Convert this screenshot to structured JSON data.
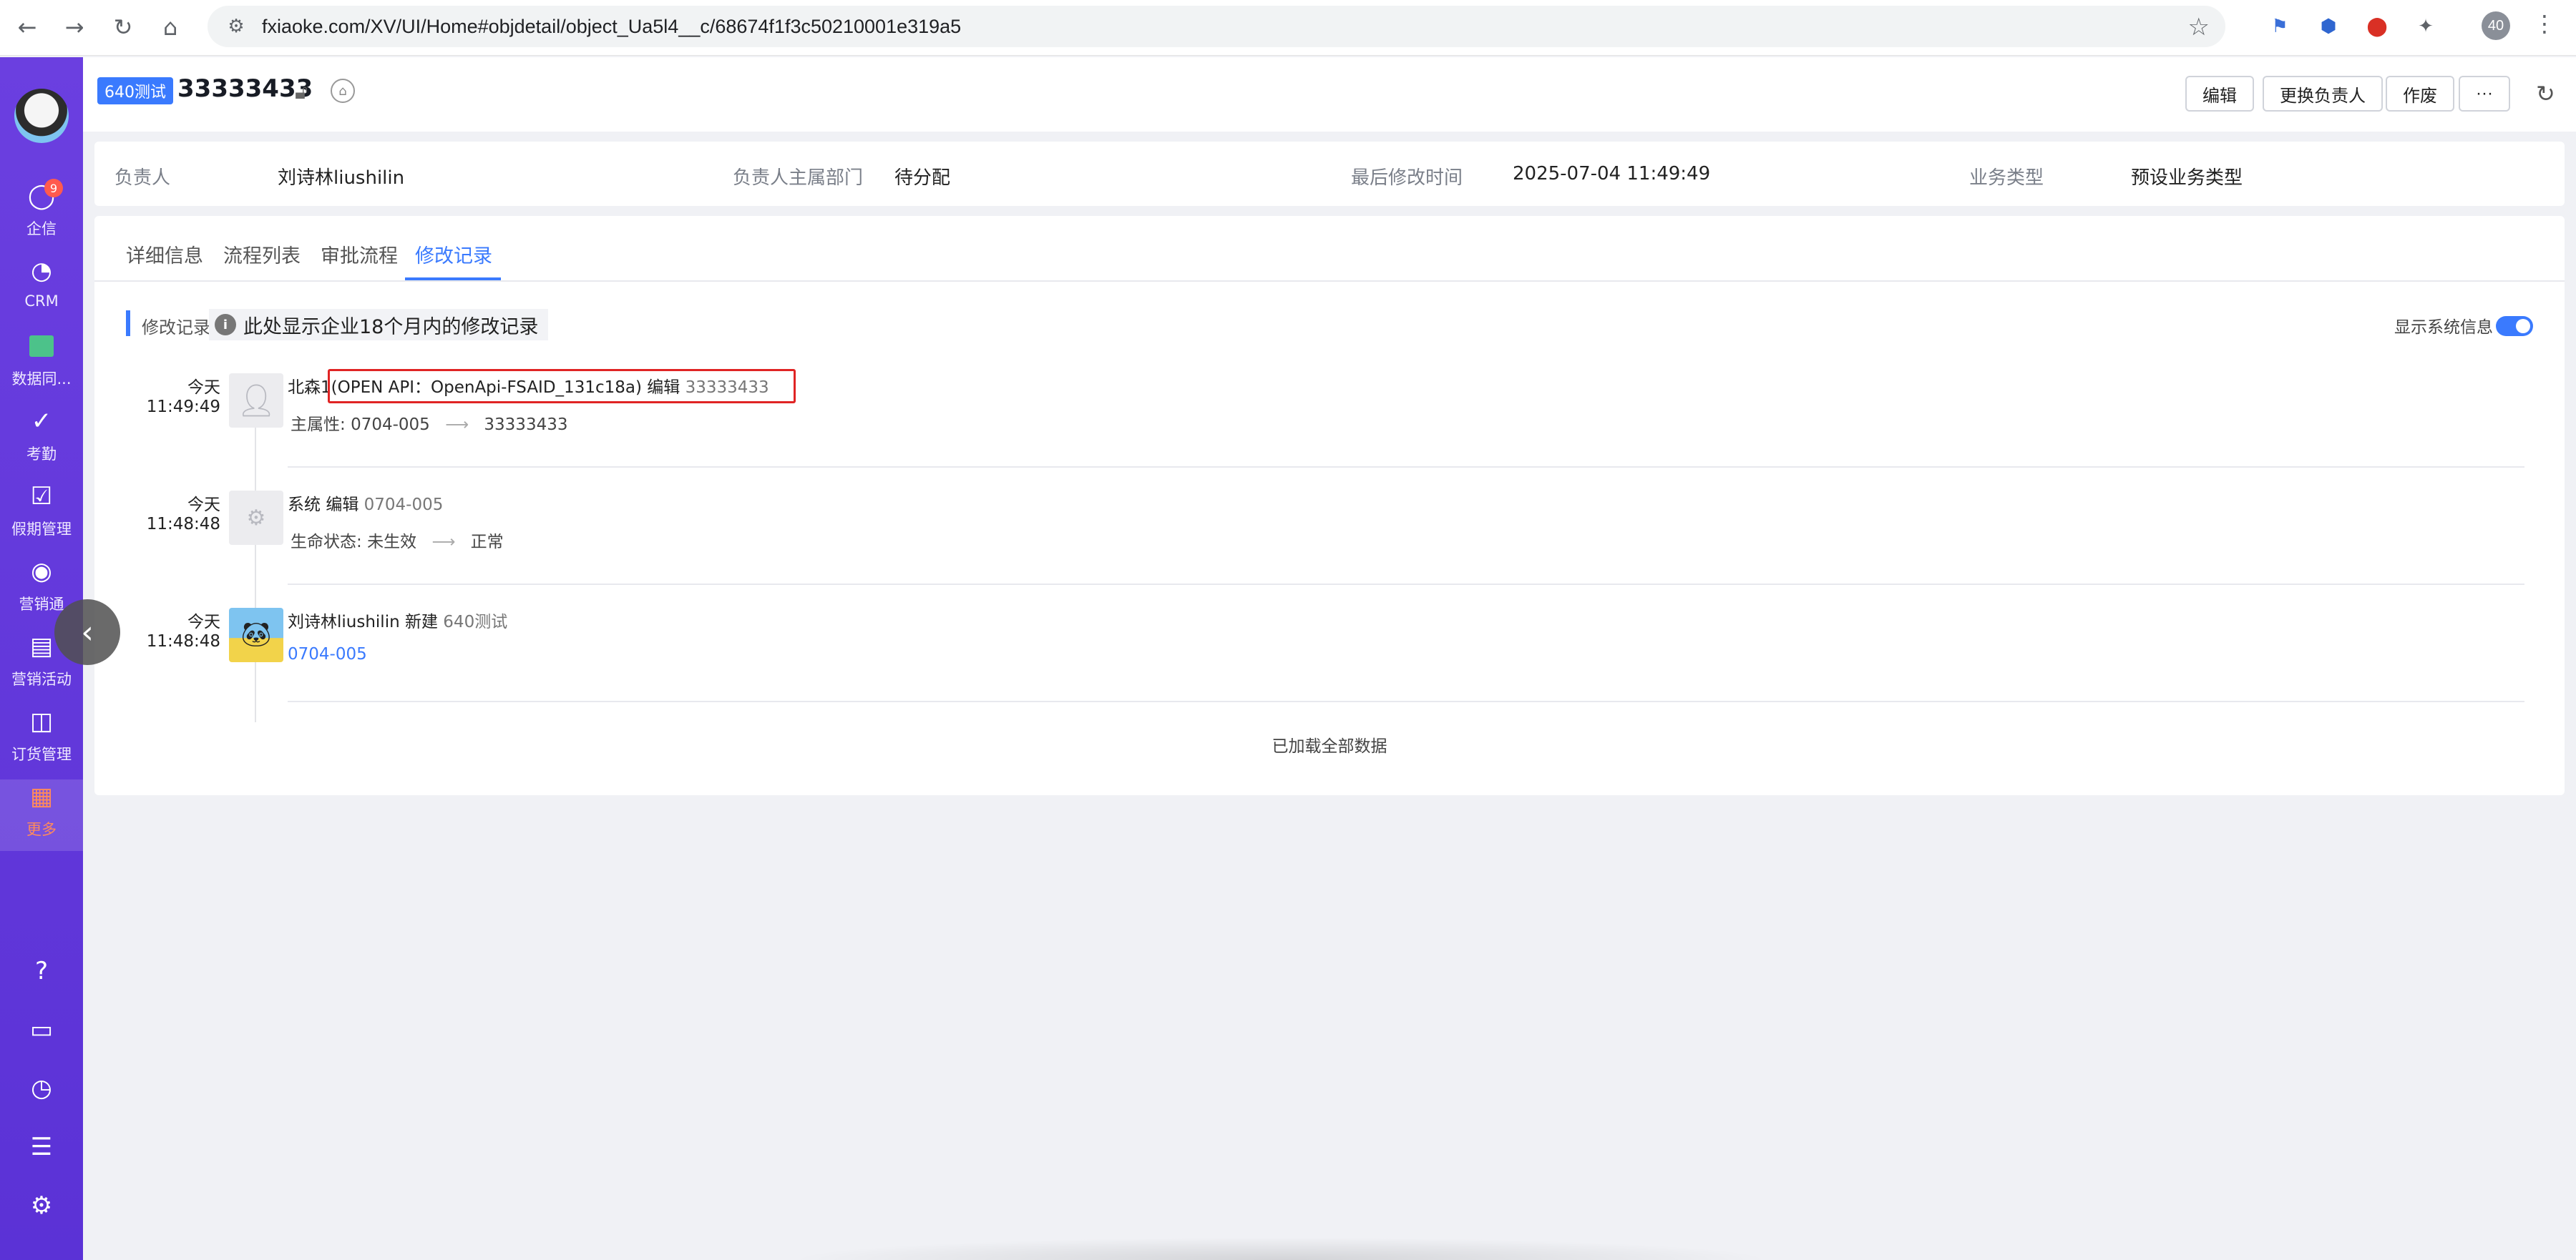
{
  "browser": {
    "url": "fxiaoke.com/XV/UI/Home#objdetail/object_Ua5l4__c/68674f1f3c50210001e319a5",
    "profile_badge": "40"
  },
  "sidebar": {
    "items": [
      {
        "label": "企信",
        "icon": "chat-icon",
        "badge": "9"
      },
      {
        "label": "CRM",
        "icon": "pie-chart-icon"
      },
      {
        "label": "数据同...",
        "icon": "data-sync-icon"
      },
      {
        "label": "考勤",
        "icon": "check-circle-icon"
      },
      {
        "label": "假期管理",
        "icon": "calendar-check-icon"
      },
      {
        "label": "营销通",
        "icon": "broadcast-icon"
      },
      {
        "label": "营销活动",
        "icon": "clipboard-icon"
      },
      {
        "label": "订货管理",
        "icon": "shopping-bag-icon"
      },
      {
        "label": "更多",
        "icon": "grid-icon",
        "active": true
      }
    ],
    "bottom_icons": [
      "help-icon",
      "book-icon",
      "clock-icon",
      "user-list-icon",
      "settings-icon"
    ]
  },
  "header": {
    "object_tag": "640测试",
    "title": "33333433",
    "buttons": {
      "edit": "编辑",
      "change_owner": "更换负责人",
      "void": "作废",
      "more": "···"
    }
  },
  "info": {
    "owner_label": "负责人",
    "owner_value": "刘诗林liushilin",
    "dept_label": "负责人主属部门",
    "dept_value": "待分配",
    "modified_label": "最后修改时间",
    "modified_value": "2025-07-04 11:49:49",
    "biztype_label": "业务类型",
    "biztype_value": "预设业务类型"
  },
  "tabs": [
    "详细信息",
    "流程列表",
    "审批流程",
    "修改记录"
  ],
  "active_tab": "修改记录",
  "section": {
    "title": "修改记录",
    "notice": "此处显示企业18个月内的修改记录",
    "system_info_label": "显示系统信息",
    "system_info_on": true
  },
  "entries": [
    {
      "day": "今天",
      "time": "11:49:49",
      "actor": "北森1",
      "source": "(OPEN API：OpenApi-FSAID_131c18a)",
      "action": "编辑",
      "target": "33333433",
      "field": "主属性:",
      "from": "0704-005",
      "arrow": "⟶",
      "to": "33333433"
    },
    {
      "day": "今天",
      "time": "11:48:48",
      "actor": "系统",
      "action": "编辑",
      "target": "0704-005",
      "field": "生命状态:",
      "from": "未生效",
      "arrow": "⟶",
      "to": "正常"
    },
    {
      "day": "今天",
      "time": "11:48:48",
      "actor": "刘诗林liushilin",
      "action": "新建",
      "target": "640测试",
      "link": "0704-005"
    }
  ],
  "footer": "已加载全部数据",
  "colors": {
    "accent": "#3a7afe",
    "sidebar": "#5b32d6",
    "highlight": "#e02424"
  }
}
